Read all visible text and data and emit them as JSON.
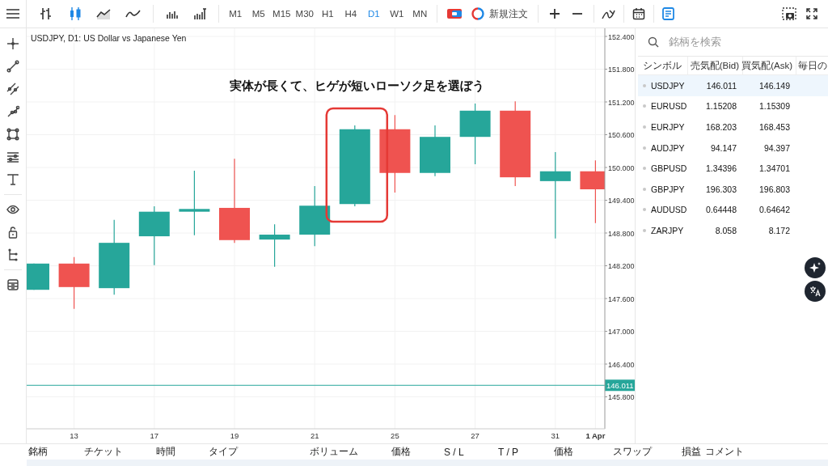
{
  "toolbar": {
    "chart_types": [
      {
        "kind": "bars",
        "selected": false
      },
      {
        "kind": "candles",
        "selected": true
      },
      {
        "kind": "area",
        "selected": false
      },
      {
        "kind": "line",
        "selected": false
      }
    ],
    "timeframes": [
      {
        "label": "M1",
        "selected": false
      },
      {
        "label": "M5",
        "selected": false
      },
      {
        "label": "M15",
        "selected": false
      },
      {
        "label": "M30",
        "selected": false
      },
      {
        "label": "H1",
        "selected": false
      },
      {
        "label": "H4",
        "selected": false
      },
      {
        "label": "D1",
        "selected": true
      },
      {
        "label": "W1",
        "selected": false
      },
      {
        "label": "MN",
        "selected": false
      }
    ],
    "new_order": "新規注文"
  },
  "chart": {
    "legend": "USDJPY, D1: US Dollar vs Japanese Yen",
    "price_labels": [
      "152.400",
      "151.800",
      "151.200",
      "150.600",
      "150.000",
      "149.400",
      "148.800",
      "148.200",
      "147.600",
      "147.000",
      "146.400",
      "145.800"
    ],
    "date_labels": [
      "13",
      "17",
      "19",
      "21",
      "25",
      "27",
      "31",
      "1 Apr"
    ],
    "current_price": "146.011",
    "callout": "実体が長くて、ヒゲが短いローソク足を選ぼう"
  },
  "watchlist": {
    "search": {
      "placeholder": "銘柄を検索"
    },
    "columns": [
      "シンボル",
      "売気配(Bid)",
      "買気配(Ask)",
      "毎日の"
    ],
    "rows": [
      {
        "symbol": "USDJPY",
        "bid": "146.011",
        "ask": "146.149",
        "selected": true
      },
      {
        "symbol": "EURUSD",
        "bid": "1.15208",
        "ask": "1.15309",
        "selected": false
      },
      {
        "symbol": "EURJPY",
        "bid": "168.203",
        "ask": "168.453",
        "selected": false
      },
      {
        "symbol": "AUDJPY",
        "bid": "94.147",
        "ask": "94.397",
        "selected": false
      },
      {
        "symbol": "GBPUSD",
        "bid": "1.34396",
        "ask": "1.34701",
        "selected": false
      },
      {
        "symbol": "GBPJPY",
        "bid": "196.303",
        "ask": "196.803",
        "selected": false
      },
      {
        "symbol": "AUDUSD",
        "bid": "0.64448",
        "ask": "0.64642",
        "selected": false
      },
      {
        "symbol": "ZARJPY",
        "bid": "8.058",
        "ask": "8.172",
        "selected": false
      }
    ]
  },
  "trade_table": {
    "columns": [
      "銘柄",
      "チケット",
      "時間",
      "タイプ",
      "ボリューム",
      "価格",
      "S / L",
      "T / P",
      "価格",
      "スワップ",
      "損益",
      "コメント"
    ]
  }
}
